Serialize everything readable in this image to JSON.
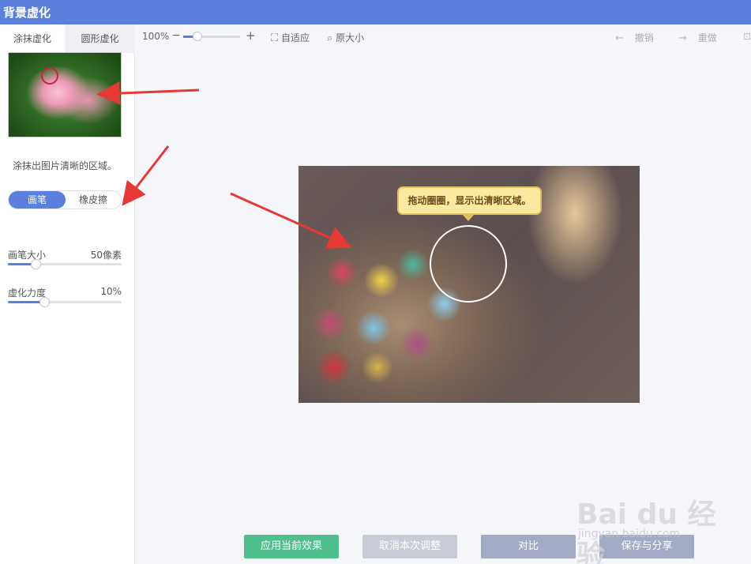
{
  "window": {
    "title": "背景虚化"
  },
  "sidebar": {
    "tabs": [
      {
        "label": "涂抹虚化"
      },
      {
        "label": "圆形虚化"
      }
    ],
    "hint": "涂抹出图片清晰的区域。",
    "mode": {
      "brush": "画笔",
      "eraser": "橡皮擦"
    },
    "brush_size": {
      "label": "画笔大小",
      "value": "50像素",
      "fraction": 0.24
    },
    "blur_strength": {
      "label": "虚化力度",
      "value": "10%",
      "fraction": 0.32
    }
  },
  "toolbar": {
    "zoom_value": "100%",
    "zoom_minus": "−",
    "zoom_plus": "+",
    "zoom_fraction": 0.25,
    "fit": "自适应",
    "original": "原大小",
    "undo": "撤销",
    "redo": "重做"
  },
  "canvas": {
    "tooltip": "拖动圈圈，显示出清晰区域。"
  },
  "actions": {
    "apply": "应用当前效果",
    "cancel": "取消本次调整",
    "compare": "对比",
    "save": "保存与分享"
  },
  "watermark": {
    "brand": "Bai du 经验",
    "url": "jingyan.baidu.com"
  },
  "colors": {
    "accent": "#5b7fdc",
    "apply": "#4fc08d",
    "annotation": "#e53935"
  }
}
